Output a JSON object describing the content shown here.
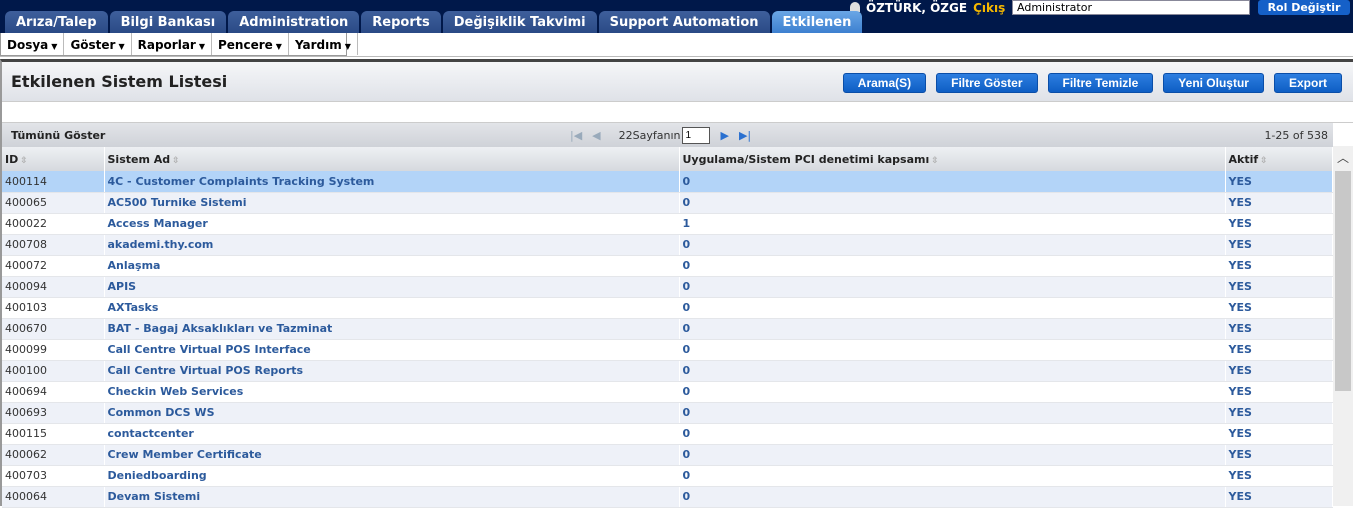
{
  "header": {
    "user": "ÖZTÜRK, ÖZGE",
    "logout": "Çıkış",
    "role": "Administrator",
    "role_button": "Rol Değiştir"
  },
  "tabs": [
    {
      "label": "Arıza/Talep"
    },
    {
      "label": "Bilgi Bankası"
    },
    {
      "label": "Administration"
    },
    {
      "label": "Reports"
    },
    {
      "label": "Değişiklik Takvimi"
    },
    {
      "label": "Support Automation"
    },
    {
      "label": "Etkilenen"
    }
  ],
  "menu": [
    {
      "label": "Dosya"
    },
    {
      "label": "Göster"
    },
    {
      "label": "Raporlar"
    },
    {
      "label": "Pencere"
    },
    {
      "label": "Yardım"
    }
  ],
  "page": {
    "title": "Etkilenen Sistem Listesi",
    "buttons": [
      "Arama(S)",
      "Filtre Göster",
      "Filtre Temizle",
      "Yeni Oluştur",
      "Export"
    ]
  },
  "pager": {
    "show_all": "Tümünü Göster",
    "pages_label": "22Sayfanın",
    "page": "1",
    "count": "1-25 of 538"
  },
  "columns": [
    "ID",
    "Sistem Ad",
    "Uygulama/Sistem PCI denetimi kapsamı",
    "Aktif"
  ],
  "rows": [
    [
      "400114",
      "4C - Customer Complaints Tracking System",
      "0",
      "YES"
    ],
    [
      "400065",
      "AC500 Turnike Sistemi",
      "0",
      "YES"
    ],
    [
      "400022",
      "Access Manager",
      "1",
      "YES"
    ],
    [
      "400708",
      "akademi.thy.com",
      "0",
      "YES"
    ],
    [
      "400072",
      "Anlaşma",
      "0",
      "YES"
    ],
    [
      "400094",
      "APIS",
      "0",
      "YES"
    ],
    [
      "400103",
      "AXTasks",
      "0",
      "YES"
    ],
    [
      "400670",
      "BAT - Bagaj Aksaklıkları ve Tazminat",
      "0",
      "YES"
    ],
    [
      "400099",
      "Call Centre Virtual POS Interface",
      "0",
      "YES"
    ],
    [
      "400100",
      "Call Centre Virtual POS Reports",
      "0",
      "YES"
    ],
    [
      "400694",
      "Checkin Web Services",
      "0",
      "YES"
    ],
    [
      "400693",
      "Common DCS WS",
      "0",
      "YES"
    ],
    [
      "400115",
      "contactcenter",
      "0",
      "YES"
    ],
    [
      "400062",
      "Crew Member Certificate",
      "0",
      "YES"
    ],
    [
      "400703",
      "Deniedboarding",
      "0",
      "YES"
    ],
    [
      "400064",
      "Devam Sistemi",
      "0",
      "YES"
    ]
  ]
}
